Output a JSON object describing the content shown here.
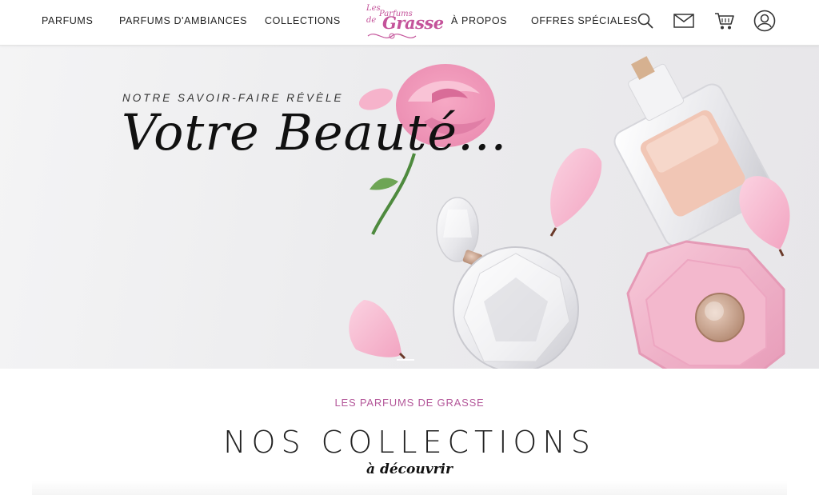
{
  "header": {
    "nav": [
      "PARFUMS",
      "PARFUMS D'AMBIANCES",
      "COLLECTIONS",
      "À PROPOS",
      "OFFRES SPÉCIALES"
    ],
    "logo": {
      "line1": "Les",
      "line2": "Parfums",
      "line3": "de",
      "line4": "Grasse"
    },
    "icons": [
      "search-icon",
      "mail-icon",
      "cart-icon",
      "user-icon"
    ]
  },
  "hero": {
    "kicker": "NOTRE SAVOIR-FAIRE RÉVÈLE",
    "title": "Votre Beauté..."
  },
  "section": {
    "kicker": "LES PARFUMS DE GRASSE",
    "title": "NOS COLLECTIONS",
    "subtitle": "à découvrir"
  },
  "colors": {
    "brand_pink": "#c4539a",
    "text_dark": "#1f1f1f"
  }
}
